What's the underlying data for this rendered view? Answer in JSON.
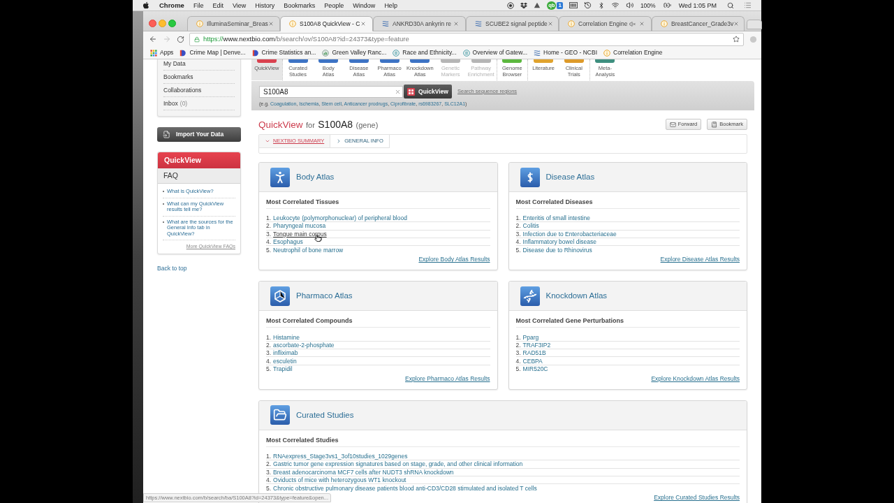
{
  "menubar": {
    "app": "Chrome",
    "menus": [
      "File",
      "Edit",
      "View",
      "History",
      "Bookmarks",
      "People",
      "Window",
      "Help"
    ],
    "badge": {
      "label": "qb",
      "count": "1"
    },
    "battery": "100%",
    "clock": "Wed 1:05 PM"
  },
  "browser": {
    "tabs": [
      {
        "title": "IlluminaSeminar_Breas",
        "kind": "info",
        "selected": false,
        "muted": false
      },
      {
        "title": "S100A8 QuickView - C",
        "kind": "info",
        "selected": true,
        "muted": false
      },
      {
        "title": "ANKRD30A ankyrin re",
        "kind": "ncbi",
        "selected": false,
        "muted": false
      },
      {
        "title": "SCUBE2 signal peptide",
        "kind": "ncbi",
        "selected": false,
        "muted": false
      },
      {
        "title": "Correlation Engine",
        "kind": "info",
        "selected": false,
        "muted": true
      },
      {
        "title": "BreastCancer_Grade3v",
        "kind": "info",
        "selected": false,
        "muted": false
      }
    ],
    "address": {
      "scheme": "https://",
      "host": "www.nextbio.com",
      "path": "/b/search/ov/S100A8?id=24373&type=feature"
    },
    "bookmarks": [
      {
        "label": "Apps",
        "kind": "apps"
      },
      {
        "label": "Crime Map | Denve...",
        "kind": "d-logo"
      },
      {
        "label": "Crime Statistics an...",
        "kind": "d-logo"
      },
      {
        "label": "Green Valley Ranc...",
        "kind": "chart"
      },
      {
        "label": "Race and Ethnicity...",
        "kind": "lines"
      },
      {
        "label": "Overview of Gatew...",
        "kind": "lines"
      },
      {
        "label": "Home - GEO - NCBI",
        "kind": "ncbi"
      },
      {
        "label": "Correlation Engine",
        "kind": "info"
      }
    ]
  },
  "sidebar": {
    "account_items": [
      {
        "label": "My Data"
      },
      {
        "label": "Bookmarks"
      },
      {
        "label": "Collaborations"
      },
      {
        "label": "Inbox",
        "count": "(0)"
      }
    ],
    "import_button": "Import Your Data",
    "panel_title": "QuickView",
    "faq_title": "FAQ",
    "faq_links": [
      "What is QuickView?",
      "What can my QuickView results tell me?",
      "What are the sources for the General Info tab in QuickView?"
    ],
    "more_link": "More QuickView FAQs",
    "back_to_top": "Back to top"
  },
  "nav": [
    {
      "items": [
        {
          "lines": [
            "QuickView"
          ],
          "color": "#d9414f",
          "selected": true,
          "disabled": false
        }
      ]
    },
    {
      "items": [
        {
          "lines": [
            "Curated",
            "Studies"
          ],
          "color": "#3d73c4",
          "selected": false,
          "disabled": false
        },
        {
          "lines": [
            "Body",
            "Atlas"
          ],
          "color": "#3d73c4",
          "selected": false,
          "disabled": false
        },
        {
          "lines": [
            "Disease",
            "Atlas"
          ],
          "color": "#3d73c4",
          "selected": false,
          "disabled": false
        },
        {
          "lines": [
            "Pharmaco",
            "Atlas"
          ],
          "color": "#3d73c4",
          "selected": false,
          "disabled": false
        },
        {
          "lines": [
            "Knockdown",
            "Atlas"
          ],
          "color": "#3d73c4",
          "selected": false,
          "disabled": false
        },
        {
          "lines": [
            "Genetic",
            "Markers"
          ],
          "color": "#b5b5b5",
          "selected": false,
          "disabled": true
        },
        {
          "lines": [
            "Pathway",
            "Enrichment"
          ],
          "color": "#b5b5b5",
          "selected": false,
          "disabled": true
        }
      ]
    },
    {
      "items": [
        {
          "lines": [
            "Genome",
            "Browser"
          ],
          "color": "#5cb83f",
          "selected": false,
          "disabled": false
        }
      ]
    },
    {
      "items": [
        {
          "lines": [
            "Literature"
          ],
          "color": "#e0a32e",
          "selected": false,
          "disabled": false
        },
        {
          "lines": [
            "Clinical",
            "Trials"
          ],
          "color": "#dd9a2a",
          "selected": false,
          "disabled": false
        }
      ]
    },
    {
      "items": [
        {
          "lines": [
            "Meta-",
            "Analysis"
          ],
          "color": "#3f8f7f",
          "selected": false,
          "disabled": false
        }
      ]
    }
  ],
  "search": {
    "value": "S100A8",
    "button": "QuickView",
    "link": "Search sequence regions",
    "examples": {
      "lead": "(e.g.",
      "links": [
        {
          "text": "Coagulation",
          "after": ","
        },
        {
          "text": "Ischemia",
          "after": ","
        },
        {
          "text": "Stem cell",
          "after": ","
        },
        {
          "text": "Anticancer prodrugs",
          "after": ","
        },
        {
          "text": "Ciprofibrate",
          "after": ","
        },
        {
          "text": "rs6983267",
          "after": ","
        },
        {
          "text": "SLC12A1",
          "after": ")"
        }
      ]
    }
  },
  "heading": {
    "prefix": "QuickView",
    "connector": "for",
    "term": "S100A8",
    "type": "(gene)"
  },
  "actions": [
    {
      "label": "Forward"
    },
    {
      "label": "Bookmark"
    }
  ],
  "tabs": [
    {
      "label": "NEXTBIO SUMMARY",
      "selected": true
    },
    {
      "label": "GENERAL INFO",
      "selected": false
    }
  ],
  "cards": [
    {
      "kind": "half",
      "title": "Body Atlas",
      "subtitle": "Most Correlated Tissues",
      "items": [
        {
          "number": "1.",
          "text": "Leukocyte (polymorphonuclear) of peripheral blood",
          "hovered": false
        },
        {
          "number": "2.",
          "text": "Pharyngeal mucosa",
          "hovered": false
        },
        {
          "number": "3.",
          "text": "Tongue main corpus",
          "hovered": true
        },
        {
          "number": "4.",
          "text": "Esophagus",
          "hovered": false
        },
        {
          "number": "5.",
          "text": "Neutrophil of bone marrow",
          "hovered": false
        }
      ],
      "explore": "Explore Body Atlas Results"
    },
    {
      "kind": "half",
      "title": "Disease Atlas",
      "subtitle": "Most Correlated Diseases",
      "items": [
        {
          "number": "1.",
          "text": "Enteritis of small intestine",
          "hovered": false
        },
        {
          "number": "2.",
          "text": "Colitis",
          "hovered": false
        },
        {
          "number": "3.",
          "text": "Infection due to Enterobacteriaceae",
          "hovered": false
        },
        {
          "number": "4.",
          "text": "Inflammatory bowel disease",
          "hovered": false
        },
        {
          "number": "5.",
          "text": "Disease due to Rhinovirus",
          "hovered": false
        }
      ],
      "explore": "Explore Disease Atlas Results"
    },
    {
      "kind": "half",
      "title": "Pharmaco Atlas",
      "subtitle": "Most Correlated Compounds",
      "items": [
        {
          "number": "1.",
          "text": "Histamine",
          "hovered": false
        },
        {
          "number": "2.",
          "text": "ascorbate-2-phosphate",
          "hovered": false
        },
        {
          "number": "3.",
          "text": "infliximab",
          "hovered": false
        },
        {
          "number": "4.",
          "text": "esculetin",
          "hovered": false
        },
        {
          "number": "5.",
          "text": "Trapidil",
          "hovered": false
        }
      ],
      "explore": "Explore Pharmaco Atlas Results"
    },
    {
      "kind": "half",
      "title": "Knockdown Atlas",
      "subtitle": "Most Correlated Gene Perturbations",
      "items": [
        {
          "number": "1.",
          "text": "Pparg",
          "hovered": false
        },
        {
          "number": "2.",
          "text": "TRAF3IP2",
          "hovered": false
        },
        {
          "number": "3.",
          "text": "RAD51B",
          "hovered": false
        },
        {
          "number": "4.",
          "text": "CEBPA",
          "hovered": false
        },
        {
          "number": "5.",
          "text": "MIR520C",
          "hovered": false
        }
      ],
      "explore": "Explore Knockdown Atlas Results"
    },
    {
      "kind": "wide",
      "title": "Curated Studies",
      "subtitle": "Most Correlated Studies",
      "items": [
        {
          "number": "1.",
          "text": "RNAexpress_Stage3vs1_3of10studies_1029genes",
          "hovered": false
        },
        {
          "number": "2.",
          "text": "Gastric tumor gene expression signatures based on stage, grade, and other clinical information",
          "hovered": false
        },
        {
          "number": "3.",
          "text": "Breast adenocarcinoma MCF7 cells after NUDT3 shRNA knockdown",
          "hovered": false
        },
        {
          "number": "4.",
          "text": "Oviducts of mice with heterozygous WT1 knockout",
          "hovered": false
        },
        {
          "number": "5.",
          "text": "Chronic obstructive pulmonary disease patients blood anti-CD3/CD28 stimulated and isolated T cells",
          "hovered": false
        }
      ],
      "explore": "Explore Curated Studies Results"
    }
  ],
  "status_url": "https://www.nextbio.com/b/search/ba/S100A8?id=24373&type=feature&open..."
}
